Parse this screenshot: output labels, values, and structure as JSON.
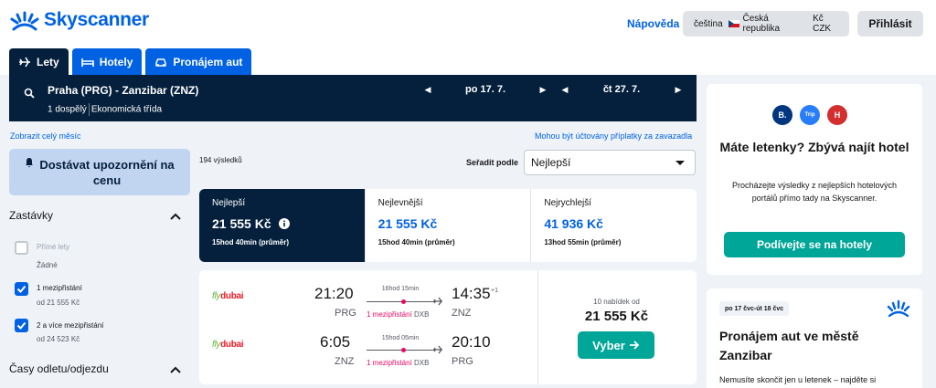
{
  "brand": {
    "name": "Skyscanner",
    "color": "#0062e3"
  },
  "header": {
    "help": "Nápověda",
    "locale": {
      "language": "čeština",
      "country": "Česká republika",
      "currency": "Kč CZK"
    },
    "login": "Přihlásit"
  },
  "tabs": [
    {
      "label": "Lety",
      "icon": "plane-icon",
      "active": true
    },
    {
      "label": "Hotely",
      "icon": "bed-icon",
      "active": false
    },
    {
      "label": "Pronájem aut",
      "icon": "car-icon",
      "active": false
    }
  ],
  "search": {
    "route": "Praha (PRG) - Zanzibar (ZNZ)",
    "passengers": "1 dospělý",
    "cabin": "Ekonomická třída",
    "depart": "po 17. 7.",
    "return": "čt 27. 7."
  },
  "links": {
    "whole_month": "Zobrazit celý měsíc",
    "fees": "Mohou být účtovány příplatky za zavazadla"
  },
  "sidebar": {
    "alert_button": "Dostávat upozornění na cenu",
    "stops_title": "Zastávky",
    "stops": [
      {
        "label": "Přímé lety",
        "sub": "Žádné",
        "checked": false,
        "disabled": true
      },
      {
        "label": "1 mezipřistání",
        "sub": "od 21 555 Kč",
        "checked": true,
        "disabled": false
      },
      {
        "label": "2 a více mezipřistání",
        "sub": "od 24 523 Kč",
        "checked": true,
        "disabled": false
      }
    ],
    "times_title": "Časy odletu/odjezdu"
  },
  "results": {
    "count": "194 výsledků",
    "sort_label": "Seřadit podle",
    "sort_value": "Nejlepší",
    "sort_tabs": [
      {
        "name": "Nejlepší",
        "price": "21 555 Kč",
        "duration": "15hod 40min (průměr)",
        "active": true
      },
      {
        "name": "Nejlevnější",
        "price": "21 555 Kč",
        "duration": "15hod 40min (průměr)",
        "active": false
      },
      {
        "name": "Nejrychlejší",
        "price": "41 936 Kč",
        "duration": "13hod 55min (průměr)",
        "active": false
      }
    ]
  },
  "flight_card": {
    "legs": [
      {
        "airline_a": "fly",
        "airline_b": "dubai",
        "dep_time": "21:20",
        "dep_code": "PRG",
        "duration": "16hod 15min",
        "stops": "1 mezipřistání",
        "via": "DXB",
        "arr_time": "14:35",
        "day_offset": "+1",
        "arr_code": "ZNZ"
      },
      {
        "airline_a": "fly",
        "airline_b": "dubai",
        "dep_time": "6:05",
        "dep_code": "ZNZ",
        "duration": "15hod 05min",
        "stops": "1 mezipřistání",
        "via": "DXB",
        "arr_time": "20:10",
        "day_offset": "",
        "arr_code": "PRG"
      }
    ],
    "offers": "10 nabídek od",
    "price": "21 555 Kč",
    "select": "Vyber"
  },
  "hotel_promo": {
    "partners": [
      {
        "label": "B.",
        "color": "#003580"
      },
      {
        "label": "Trip",
        "color": "#287dfa"
      },
      {
        "label": "H",
        "color": "#d32f2f"
      }
    ],
    "title": "Máte letenky? Zbývá najít hotel",
    "desc": "Procházejte výsledky z nejlepších hotelových portálů přímo tady na Skyscanner.",
    "button": "Podívejte se na hotely"
  },
  "car_promo": {
    "badge": "po 17 čvc-út 18 čvc",
    "title": "Pronájem aut ve městě Zanzibar",
    "desc": "Nemusíte skončit jen u letenek – najděte si"
  }
}
